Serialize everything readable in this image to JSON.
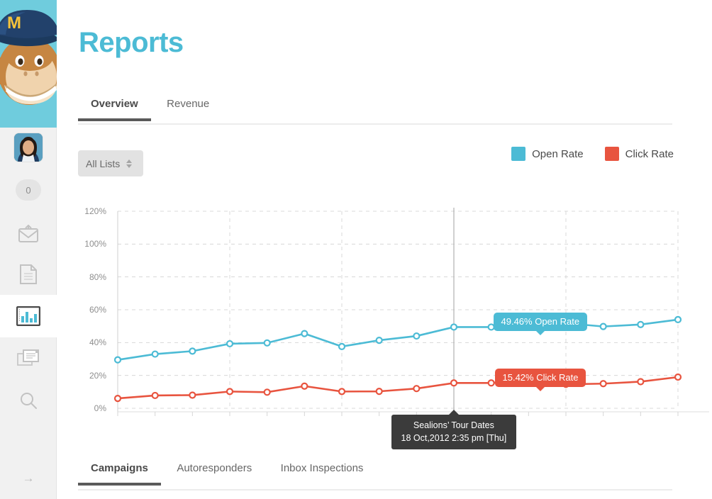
{
  "app": {
    "brand_color": "#6fccdd",
    "accent_color": "#4cbbd5",
    "logo_name": "mailchimp-freddie-logo"
  },
  "sidebar": {
    "badge_count": "0",
    "items": [
      {
        "name": "campaigns-icon",
        "label": "Campaigns",
        "active": false
      },
      {
        "name": "lists-icon",
        "label": "Lists",
        "active": false
      },
      {
        "name": "reports-icon",
        "label": "Reports",
        "active": true
      },
      {
        "name": "templates-icon",
        "label": "Templates",
        "active": false
      },
      {
        "name": "search-icon",
        "label": "Search",
        "active": false
      }
    ],
    "expand_arrow": "→"
  },
  "header": {
    "title": "Reports"
  },
  "tabs_top": [
    {
      "label": "Overview",
      "active": true
    },
    {
      "label": "Revenue",
      "active": false
    }
  ],
  "filter": {
    "selected": "All Lists",
    "options": [
      "All Lists"
    ]
  },
  "legend": [
    {
      "label": "Open Rate",
      "color": "#4cbbd5"
    },
    {
      "label": "Click Rate",
      "color": "#e8543f"
    }
  ],
  "hover": {
    "campaign_name": "Sealions’ Tour Dates",
    "timestamp": "18 Oct,2012 2:35 pm [Thu]",
    "open_rate_label": "49.46% Open Rate",
    "click_rate_label": "15.42% Click Rate"
  },
  "tabs_bottom": [
    {
      "label": "Campaigns",
      "active": true
    },
    {
      "label": "Autoresponders",
      "active": false
    },
    {
      "label": "Inbox Inspections",
      "active": false
    }
  ],
  "chart_data": {
    "type": "line",
    "title": "",
    "xlabel": "",
    "ylabel": "",
    "ylim": [
      0,
      120
    ],
    "yticks": [
      "0%",
      "20%",
      "40%",
      "60%",
      "80%",
      "100%",
      "120%"
    ],
    "ytick_values": [
      0,
      20,
      40,
      60,
      80,
      100,
      120
    ],
    "grid": true,
    "legend_position": "top-right",
    "x_count": 16,
    "highlight_index": 9,
    "series": [
      {
        "name": "Open Rate",
        "color": "#4cbbd5",
        "values": [
          29.5,
          33.0,
          34.8,
          39.3,
          39.8,
          45.5,
          37.6,
          41.4,
          44.0,
          49.46,
          49.46,
          49.3,
          51.8,
          49.8,
          51.0,
          54.0
        ]
      },
      {
        "name": "Click Rate",
        "color": "#e8543f",
        "values": [
          6.0,
          7.8,
          8.0,
          10.2,
          9.8,
          13.5,
          10.2,
          10.3,
          12.0,
          15.42,
          15.42,
          17.2,
          14.6,
          15.0,
          16.2,
          19.0
        ]
      }
    ]
  }
}
